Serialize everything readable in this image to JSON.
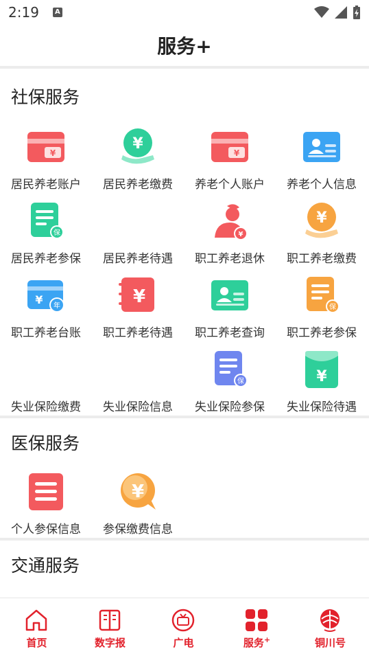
{
  "status_bar": {
    "time": "2:19"
  },
  "header": {
    "title": "服务+"
  },
  "sections": {
    "social": {
      "title": "社保服务",
      "items": [
        {
          "label": "居民养老账户",
          "icon": "card-icon"
        },
        {
          "label": "居民养老缴费",
          "icon": "hand-coin-icon"
        },
        {
          "label": "养老个人账户",
          "icon": "card-icon"
        },
        {
          "label": "养老个人信息",
          "icon": "id-card-icon"
        },
        {
          "label": "居民养老参保",
          "icon": "insurance-doc-icon"
        },
        {
          "label": "居民养老待遇",
          "icon": ""
        },
        {
          "label": "职工养老退休",
          "icon": "retiree-icon"
        },
        {
          "label": "职工养老缴费",
          "icon": "hand-coin-icon"
        },
        {
          "label": "职工养老台账",
          "icon": "year-card-icon"
        },
        {
          "label": "职工养老待遇",
          "icon": "yuan-notebook-icon"
        },
        {
          "label": "职工养老查询",
          "icon": "id-card-icon"
        },
        {
          "label": "职工养老参保",
          "icon": "insurance-doc-icon"
        },
        {
          "label": "失业保险缴费",
          "icon": ""
        },
        {
          "label": "失业保险信息",
          "icon": ""
        },
        {
          "label": "失业保险参保",
          "icon": "insurance-doc-icon"
        },
        {
          "label": "失业保险待遇",
          "icon": "envelope-yuan-icon"
        }
      ]
    },
    "medical": {
      "title": "医保服务",
      "items": [
        {
          "label": "个人参保信息",
          "icon": "list-icon"
        },
        {
          "label": "参保缴费信息",
          "icon": "yuan-bubble-icon"
        }
      ]
    },
    "traffic": {
      "title": "交通服务"
    }
  },
  "bottom_nav": [
    {
      "label": "首页",
      "icon": "home-icon"
    },
    {
      "label": "数字报",
      "icon": "newspaper-icon"
    },
    {
      "label": "广电",
      "icon": "tv-icon"
    },
    {
      "label": "服务",
      "suffix": "+",
      "icon": "services-grid-icon"
    },
    {
      "label": "铜川号",
      "icon": "tongchuan-logo-icon"
    }
  ],
  "colors": {
    "accent": "#e2222c",
    "red_icon": "#f35a5e",
    "green_icon": "#2ecf9a",
    "blue_icon": "#3ba4f3",
    "orange_icon": "#f7a440",
    "purple_icon": "#6f86ef"
  }
}
